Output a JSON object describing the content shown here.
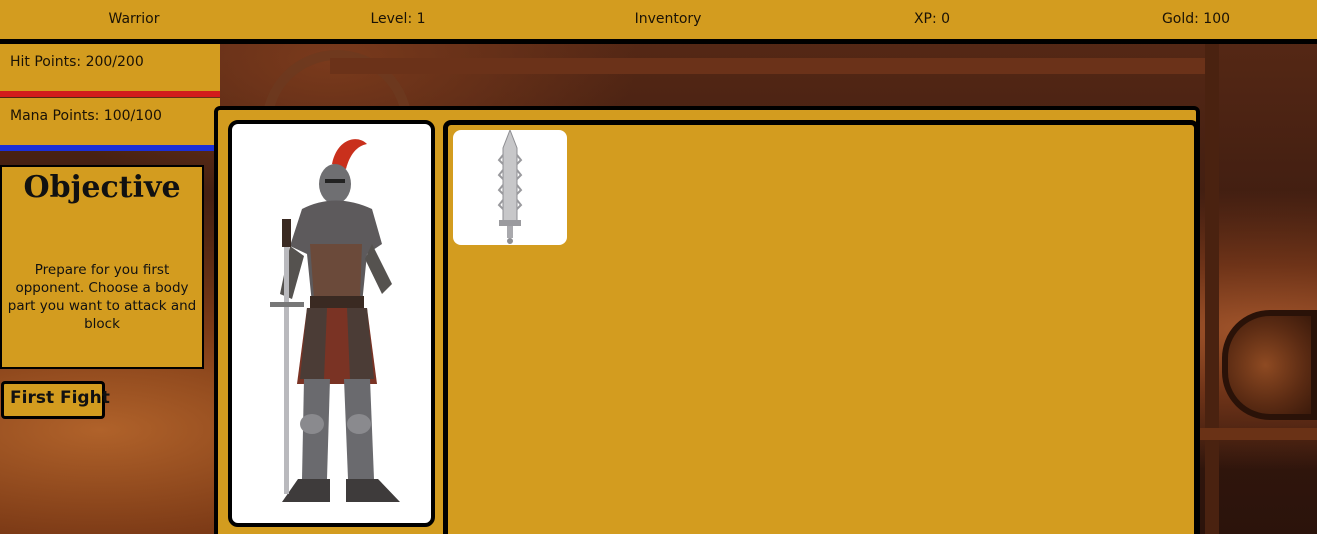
{
  "topbar": {
    "class_name": "Warrior",
    "level": "Level: 1",
    "inventory": "Inventory",
    "xp": "XP: 0",
    "gold": "Gold: 100"
  },
  "stats": {
    "hp": "Hit Points: 200/200",
    "mp": "Mana Points: 100/100",
    "hp_fraction": 1.0,
    "mp_fraction": 1.0,
    "hp_color": "#d21c1c",
    "mp_color": "#1b2fd6"
  },
  "objective": {
    "title": "Objective",
    "text": "Prepare for you first opponent. Choose a body part you want to attack and block"
  },
  "actions": {
    "fight_label": "First Fight"
  },
  "inventory_items": [
    {
      "icon": "sword-icon"
    }
  ],
  "colors": {
    "panel": "#d39c1f",
    "border": "#000000"
  }
}
